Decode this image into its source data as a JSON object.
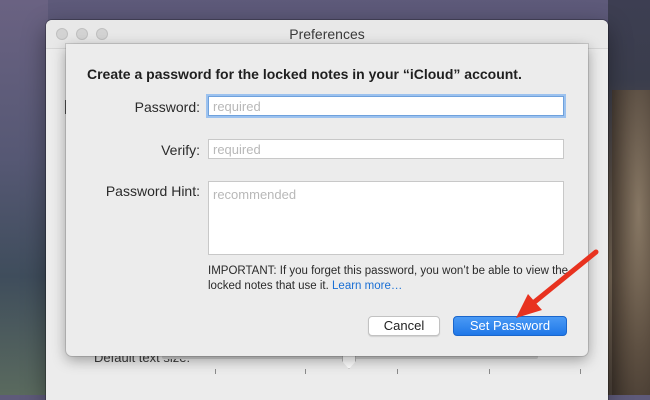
{
  "window": {
    "title": "Preferences"
  },
  "background": {
    "default_text_size_label": "Default text size:"
  },
  "sheet": {
    "heading": "Create a password for the locked notes in your “iCloud” account.",
    "password": {
      "label": "Password:",
      "placeholder": "required",
      "value": ""
    },
    "verify": {
      "label": "Verify:",
      "placeholder": "required",
      "value": ""
    },
    "hint": {
      "label": "Password Hint:",
      "placeholder": "recommended",
      "value": ""
    },
    "important_text": "IMPORTANT: If you forget this password, you won’t be able to view the locked notes that use it.",
    "learn_more": "Learn more…",
    "cancel_label": "Cancel",
    "set_password_label": "Set Password"
  },
  "colors": {
    "accent": "#1f77e8",
    "annotation_arrow": "#e8321f"
  },
  "icons": {
    "annotation": "red-arrow-icon"
  }
}
